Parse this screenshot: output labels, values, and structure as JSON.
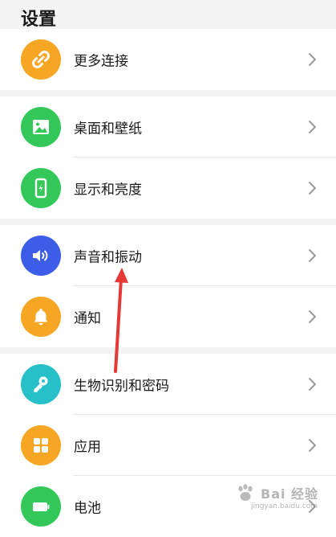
{
  "page": {
    "title": "设置"
  },
  "colors": {
    "more_connections": "#f6a623",
    "wallpaper": "#34c759",
    "display": "#34c759",
    "sound": "#3b5de7",
    "notifications": "#f6a623",
    "biometrics": "#27c0c8",
    "apps": "#f6a623",
    "battery": "#34c759",
    "annotation_arrow": "#e53935"
  },
  "sections": [
    {
      "items": [
        {
          "label": "更多连接",
          "icon": "link-icon"
        }
      ]
    },
    {
      "items": [
        {
          "label": "桌面和壁纸",
          "icon": "image-icon"
        },
        {
          "label": "显示和亮度",
          "icon": "phone-brightness-icon"
        }
      ]
    },
    {
      "items": [
        {
          "label": "声音和振动",
          "icon": "speaker-icon"
        },
        {
          "label": "通知",
          "icon": "bell-icon"
        }
      ]
    },
    {
      "items": [
        {
          "label": "生物识别和密码",
          "icon": "key-icon"
        },
        {
          "label": "应用",
          "icon": "grid-icon"
        },
        {
          "label": "电池",
          "icon": "battery-icon"
        }
      ]
    }
  ],
  "watermark": {
    "text": "Bai 经验",
    "url": "jingyan.baidu.com"
  }
}
